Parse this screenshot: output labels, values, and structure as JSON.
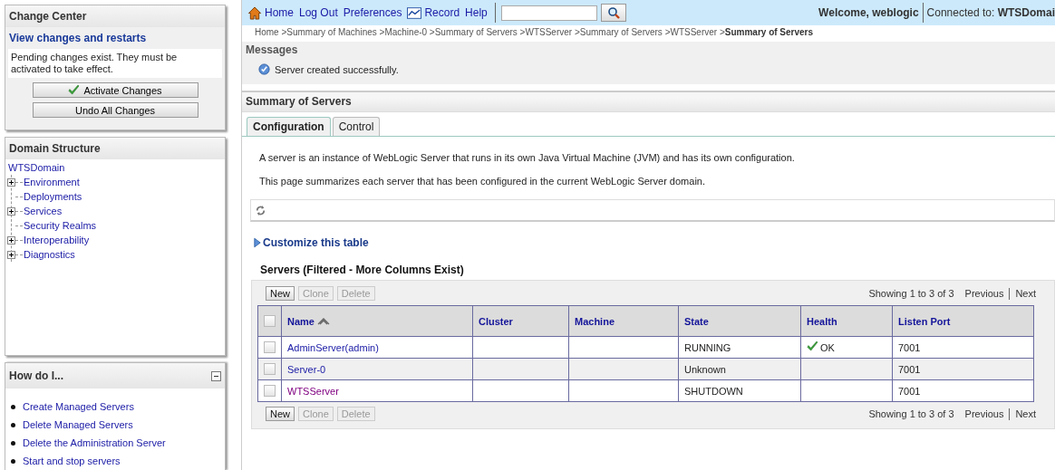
{
  "change_center": {
    "title": "Change Center",
    "link": "View changes and restarts",
    "message": "Pending changes exist. They must be activated to take effect.",
    "buttons": [
      {
        "label": "Activate Changes",
        "kind": "activate"
      },
      {
        "label": "Undo All Changes",
        "kind": "undo"
      }
    ]
  },
  "domain_structure": {
    "title": "Domain Structure",
    "root": "WTSDomain",
    "children": [
      {
        "label": "Environment",
        "expandable": true
      },
      {
        "label": "Deployments",
        "expandable": false
      },
      {
        "label": "Services",
        "expandable": true
      },
      {
        "label": "Security Realms",
        "expandable": false
      },
      {
        "label": "Interoperability",
        "expandable": true
      },
      {
        "label": "Diagnostics",
        "expandable": true
      }
    ]
  },
  "how_do_i": {
    "title": "How do I...",
    "items": [
      "Create Managed Servers",
      "Delete Managed Servers",
      "Delete the Administration Server",
      "Start and stop servers"
    ]
  },
  "toolbar": {
    "links": [
      {
        "label": "Home",
        "kind": "home"
      },
      {
        "label": "Log Out",
        "kind": "plain"
      },
      {
        "label": "Preferences",
        "kind": "plain"
      },
      {
        "label": "Record",
        "kind": "record"
      },
      {
        "label": "Help",
        "kind": "plain"
      }
    ],
    "welcome": "Welcome, weblogic",
    "connected": "Connected to: **WTSDomai**"
  },
  "breadcrumb": "Home >Summary of Machines >Machine-0 >Summary of Servers >WTSServer >Summary of Servers >WTSServer >**Summary of Servers**",
  "messages": {
    "title": "Messages",
    "text": "Server created successfully."
  },
  "summary": {
    "title": "Summary of Servers",
    "tabs": [
      {
        "label": "Configuration",
        "selected": true
      },
      {
        "label": "Control",
        "selected": false
      }
    ],
    "descriptions": [
      "A server is an instance of WebLogic Server that runs in its own Java Virtual Machine (JVM) and has its own configuration.",
      "This page summarizes each server that has been configured in the current WebLogic Server domain."
    ],
    "customize": "Customize this table",
    "table": {
      "title": "Servers (Filtered - More Columns Exist)",
      "select_all_checked": false,
      "controls": [
        {
          "buttons": [
            {
              "label": "New",
              "disabled": false
            },
            {
              "label": "Clone",
              "disabled": true
            },
            {
              "label": "Delete",
              "disabled": true
            }
          ],
          "paging": {
            "showing": "Showing 1 to 3 of 3",
            "previous": "Previous",
            "next": "Next"
          }
        },
        {
          "buttons": [
            {
              "label": "New",
              "disabled": false
            },
            {
              "label": "Clone",
              "disabled": true
            },
            {
              "label": "Delete",
              "disabled": true
            }
          ],
          "paging": {
            "showing": "Showing 1 to 3 of 3",
            "previous": "Previous",
            "next": "Next"
          }
        }
      ],
      "columns": [
        "Name",
        "Cluster",
        "Machine",
        "State",
        "Health",
        "Listen Port"
      ],
      "rows": [
        {
          "checked": false,
          "name": "AdminServer(admin)",
          "visited": false,
          "cluster": "",
          "machine": "",
          "state": "RUNNING",
          "healthy": true,
          "health": "OK",
          "port": "7001"
        },
        {
          "checked": false,
          "name": "Server-0",
          "visited": false,
          "cluster": "",
          "machine": "",
          "state": "Unknown",
          "healthy": false,
          "health": "",
          "port": "7001"
        },
        {
          "checked": false,
          "name": "WTSServer",
          "visited": true,
          "cluster": "",
          "machine": "",
          "state": "SHUTDOWN",
          "healthy": false,
          "health": "",
          "port": "7001"
        }
      ]
    }
  }
}
